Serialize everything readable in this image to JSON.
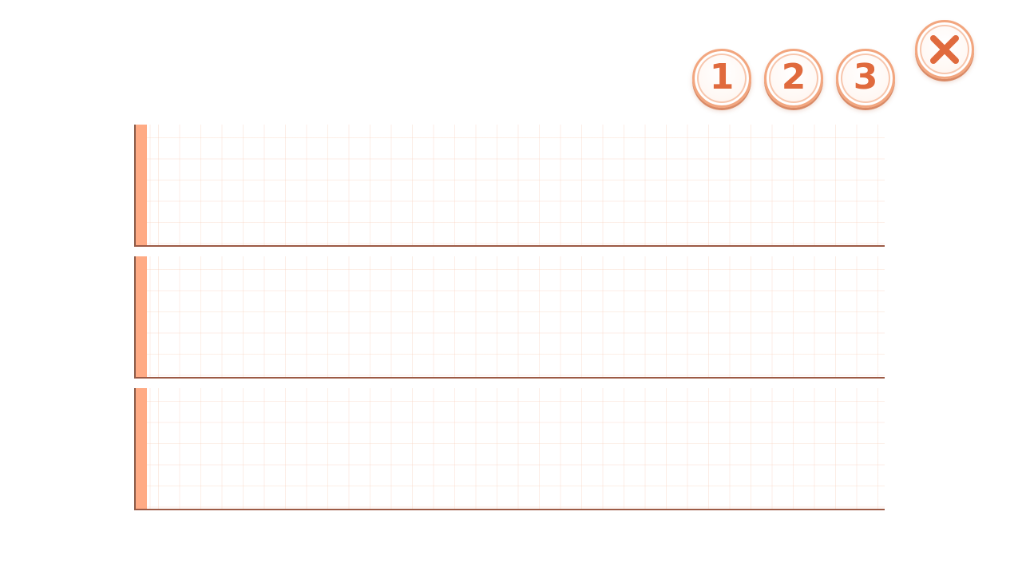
{
  "toolbar": {
    "buttons": [
      {
        "label": "1",
        "icon": "number-one-icon"
      },
      {
        "label": "2",
        "icon": "number-two-icon"
      },
      {
        "label": "3",
        "icon": "number-three-icon"
      }
    ],
    "close": {
      "icon": "close-icon"
    }
  },
  "panels": [
    {
      "text": ""
    },
    {
      "text": ""
    },
    {
      "text": ""
    }
  ],
  "colors": {
    "accent": "#e06a3d",
    "button_ring": "#f2a67f",
    "panel_bar": "#ffab85",
    "panel_line": "#9c5a45",
    "grid": "#f8cdb9"
  }
}
